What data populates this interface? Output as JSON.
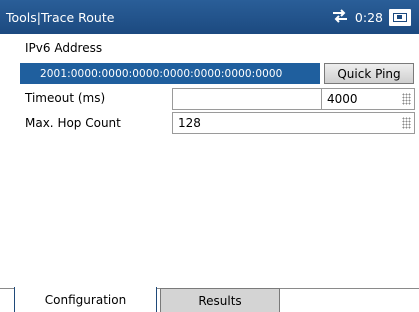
{
  "titlebar": {
    "title": "Tools|Trace Route",
    "time": "0:28",
    "icons": [
      "network-sync-icon",
      "battery-icon"
    ]
  },
  "ipv6": {
    "label": "IPv6 Address",
    "value": "2001:0000:0000:0000:0000:0000:0000:0000",
    "quick_ping_label": "Quick Ping"
  },
  "timeout": {
    "label": "Timeout (ms)",
    "value": "4000"
  },
  "max_hop": {
    "label": "Max. Hop Count",
    "value": "128"
  },
  "tabs": [
    {
      "label": "Configuration",
      "active": true
    },
    {
      "label": "Results",
      "active": false
    }
  ],
  "colors": {
    "titlebar": "#1c4a80",
    "selected_field": "#1f5f9e"
  }
}
